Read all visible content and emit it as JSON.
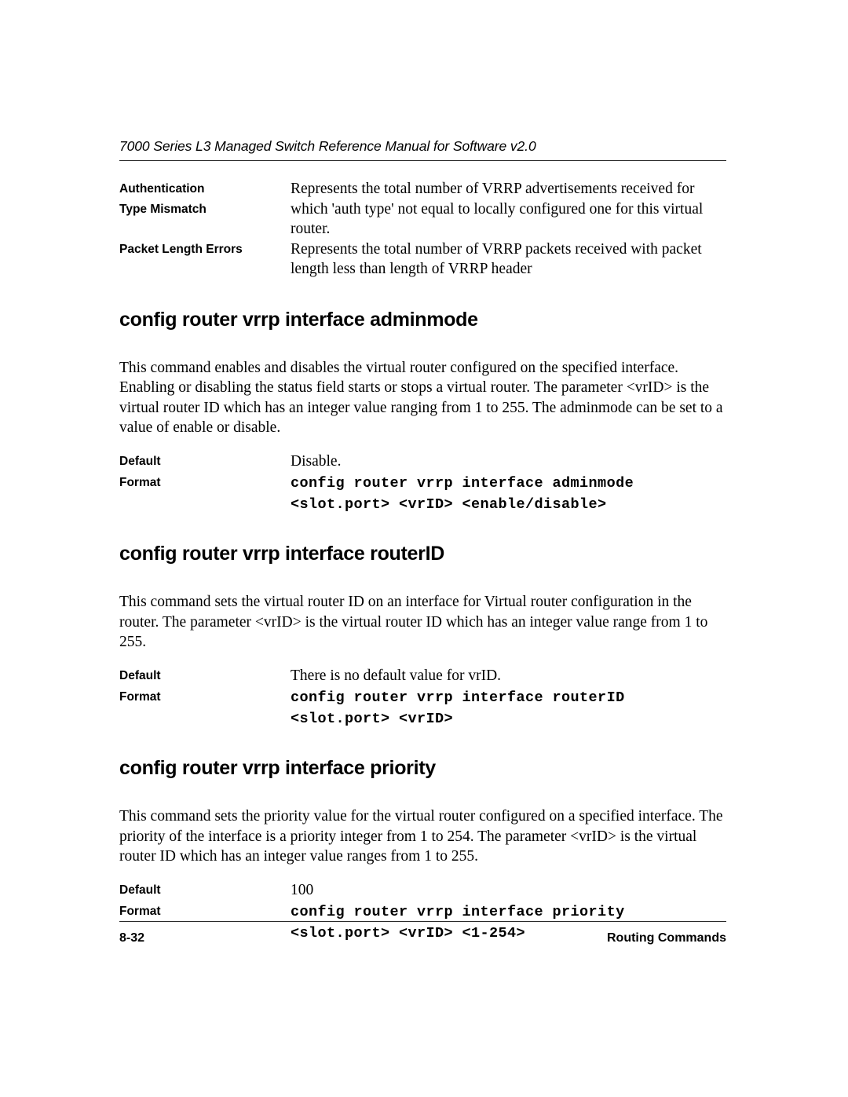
{
  "header": {
    "title": "7000 Series L3 Managed Switch Reference Manual for Software v2.0"
  },
  "stats_table": {
    "rows": [
      {
        "label_line1": "Authentication",
        "label_line2": "Type Mismatch",
        "description": "Represents the total number of VRRP advertisements received for which 'auth type' not equal to locally configured one for this virtual router."
      },
      {
        "label_line1": "Packet Length Errors",
        "label_line2": "",
        "description": "Represents the total number of VRRP packets received with packet length less than length of VRRP header"
      }
    ]
  },
  "sections": [
    {
      "heading": "config router vrrp interface adminmode",
      "description": "This command enables and disables the virtual router configured on the specified interface. Enabling or disabling the status field starts or stops a virtual router. The parameter <vrID> is the virtual router ID which has an integer value ranging from 1 to 255. The adminmode can be set to a value of enable or disable.",
      "default_label": "Default",
      "default_value": "Disable.",
      "format_label": "Format",
      "format_command": "config router vrrp interface adminmode",
      "format_params": "<slot.port> <vrID> <enable/disable>"
    },
    {
      "heading": "config router vrrp interface routerID",
      "description": "This command sets the virtual router ID on an interface for Virtual router configuration in the router. The parameter <vrID> is the virtual router ID which has an integer value range from 1 to 255.",
      "default_label": "Default",
      "default_value": "There is no default value for vrID.",
      "format_label": "Format",
      "format_command": "config router vrrp interface routerID",
      "format_params": "<slot.port> <vrID>"
    },
    {
      "heading": "config router vrrp interface priority",
      "description": "This command sets the priority value for the virtual router configured on a specified interface. The priority of the interface is a priority integer from 1 to 254. The parameter <vrID> is the virtual router ID which has an integer value ranges from 1 to 255.",
      "default_label": "Default",
      "default_value": "100",
      "format_label": "Format",
      "format_command": "config router vrrp interface priority",
      "format_params": "<slot.port> <vrID> <1-254>"
    }
  ],
  "footer": {
    "page_number": "8-32",
    "chapter_title": "Routing Commands"
  }
}
